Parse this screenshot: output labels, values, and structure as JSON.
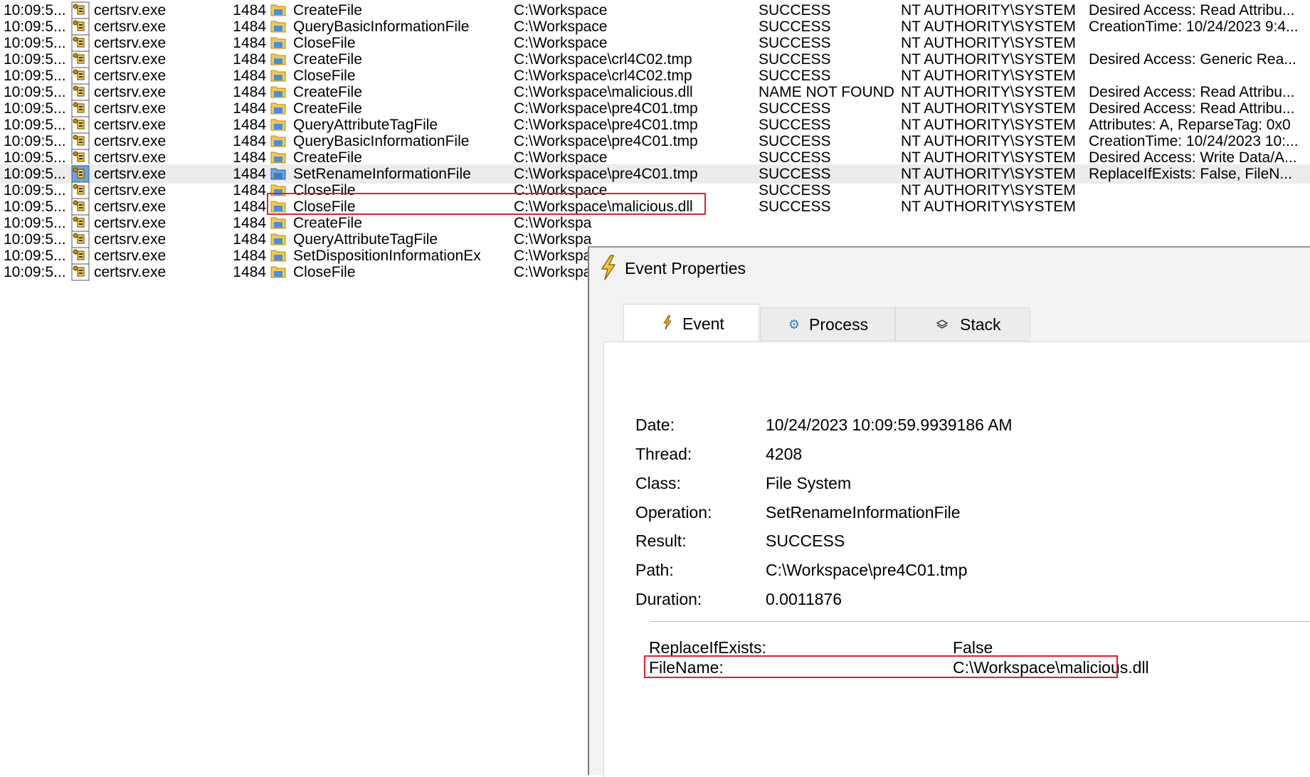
{
  "event_list": {
    "rows": [
      {
        "time": "10:09:5...",
        "process": "certsrv.exe",
        "pid": "1484",
        "operation": "CreateFile",
        "path": "C:\\Workspace",
        "result": "SUCCESS",
        "user": "NT AUTHORITY\\SYSTEM",
        "detail": "Desired Access: Read Attribu..."
      },
      {
        "time": "10:09:5...",
        "process": "certsrv.exe",
        "pid": "1484",
        "operation": "QueryBasicInformationFile",
        "path": "C:\\Workspace",
        "result": "SUCCESS",
        "user": "NT AUTHORITY\\SYSTEM",
        "detail": "CreationTime: 10/24/2023 9:4..."
      },
      {
        "time": "10:09:5...",
        "process": "certsrv.exe",
        "pid": "1484",
        "operation": "CloseFile",
        "path": "C:\\Workspace",
        "result": "SUCCESS",
        "user": "NT AUTHORITY\\SYSTEM",
        "detail": ""
      },
      {
        "time": "10:09:5...",
        "process": "certsrv.exe",
        "pid": "1484",
        "operation": "CreateFile",
        "path": "C:\\Workspace\\crl4C02.tmp",
        "result": "SUCCESS",
        "user": "NT AUTHORITY\\SYSTEM",
        "detail": "Desired Access: Generic Rea..."
      },
      {
        "time": "10:09:5...",
        "process": "certsrv.exe",
        "pid": "1484",
        "operation": "CloseFile",
        "path": "C:\\Workspace\\crl4C02.tmp",
        "result": "SUCCESS",
        "user": "NT AUTHORITY\\SYSTEM",
        "detail": ""
      },
      {
        "time": "10:09:5...",
        "process": "certsrv.exe",
        "pid": "1484",
        "operation": "CreateFile",
        "path": "C:\\Workspace\\malicious.dll",
        "result": "NAME NOT FOUND",
        "user": "NT AUTHORITY\\SYSTEM",
        "detail": "Desired Access: Read Attribu..."
      },
      {
        "time": "10:09:5...",
        "process": "certsrv.exe",
        "pid": "1484",
        "operation": "CreateFile",
        "path": "C:\\Workspace\\pre4C01.tmp",
        "result": "SUCCESS",
        "user": "NT AUTHORITY\\SYSTEM",
        "detail": "Desired Access: Read Attribu..."
      },
      {
        "time": "10:09:5...",
        "process": "certsrv.exe",
        "pid": "1484",
        "operation": "QueryAttributeTagFile",
        "path": "C:\\Workspace\\pre4C01.tmp",
        "result": "SUCCESS",
        "user": "NT AUTHORITY\\SYSTEM",
        "detail": "Attributes: A, ReparseTag: 0x0"
      },
      {
        "time": "10:09:5...",
        "process": "certsrv.exe",
        "pid": "1484",
        "operation": "QueryBasicInformationFile",
        "path": "C:\\Workspace\\pre4C01.tmp",
        "result": "SUCCESS",
        "user": "NT AUTHORITY\\SYSTEM",
        "detail": "CreationTime: 10/24/2023 10:..."
      },
      {
        "time": "10:09:5...",
        "process": "certsrv.exe",
        "pid": "1484",
        "operation": "CreateFile",
        "path": "C:\\Workspace",
        "result": "SUCCESS",
        "user": "NT AUTHORITY\\SYSTEM",
        "detail": "Desired Access: Write Data/A..."
      },
      {
        "time": "10:09:5...",
        "process": "certsrv.exe",
        "pid": "1484",
        "operation": "SetRenameInformationFile",
        "path": "C:\\Workspace\\pre4C01.tmp",
        "result": "SUCCESS",
        "user": "NT AUTHORITY\\SYSTEM",
        "detail": "ReplaceIfExists: False, FileN...",
        "selected": true
      },
      {
        "time": "10:09:5...",
        "process": "certsrv.exe",
        "pid": "1484",
        "operation": "CloseFile",
        "path": "C:\\Workspace",
        "result": "SUCCESS",
        "user": "NT AUTHORITY\\SYSTEM",
        "detail": ""
      },
      {
        "time": "10:09:5...",
        "process": "certsrv.exe",
        "pid": "1484",
        "operation": "CloseFile",
        "path": "C:\\Workspace\\malicious.dll",
        "result": "SUCCESS",
        "user": "NT AUTHORITY\\SYSTEM",
        "detail": ""
      },
      {
        "time": "10:09:5...",
        "process": "certsrv.exe",
        "pid": "1484",
        "operation": "CreateFile",
        "path": "C:\\Workspa",
        "result": "",
        "user": "",
        "detail": ""
      },
      {
        "time": "10:09:5...",
        "process": "certsrv.exe",
        "pid": "1484",
        "operation": "QueryAttributeTagFile",
        "path": "C:\\Workspa",
        "result": "",
        "user": "",
        "detail": ""
      },
      {
        "time": "10:09:5...",
        "process": "certsrv.exe",
        "pid": "1484",
        "operation": "SetDispositionInformationEx",
        "path": "C:\\Workspa",
        "result": "",
        "user": "",
        "detail": ""
      },
      {
        "time": "10:09:5...",
        "process": "certsrv.exe",
        "pid": "1484",
        "operation": "CloseFile",
        "path": "C:\\Workspa",
        "result": "",
        "user": "",
        "detail": ""
      }
    ]
  },
  "props": {
    "title": "Event Properties",
    "title_icon": "lightning-icon",
    "tabs": [
      {
        "label": "Event",
        "icon": "lightning-icon"
      },
      {
        "label": "Process",
        "icon": "gear-icon"
      },
      {
        "label": "Stack",
        "icon": "layers-icon"
      }
    ],
    "fields": [
      {
        "label": "Date:",
        "value": "10/24/2023 10:09:59.9939186 AM"
      },
      {
        "label": "Thread:",
        "value": "4208"
      },
      {
        "label": "Class:",
        "value": "File System"
      },
      {
        "label": "Operation:",
        "value": "SetRenameInformationFile"
      },
      {
        "label": "Result:",
        "value": "SUCCESS"
      },
      {
        "label": "Path:",
        "value": "C:\\Workspace\\pre4C01.tmp"
      },
      {
        "label": "Duration:",
        "value": "0.0011876"
      }
    ],
    "details": [
      {
        "label": "ReplaceIfExists:",
        "value": "False"
      },
      {
        "label": "FileName:",
        "value": "C:\\Workspace\\malicious.dll"
      }
    ]
  },
  "colors": {
    "highlight": "#e0202c",
    "selected_row": "#ececec",
    "folder": "#f2c94c",
    "lightning": "#e8a317"
  }
}
